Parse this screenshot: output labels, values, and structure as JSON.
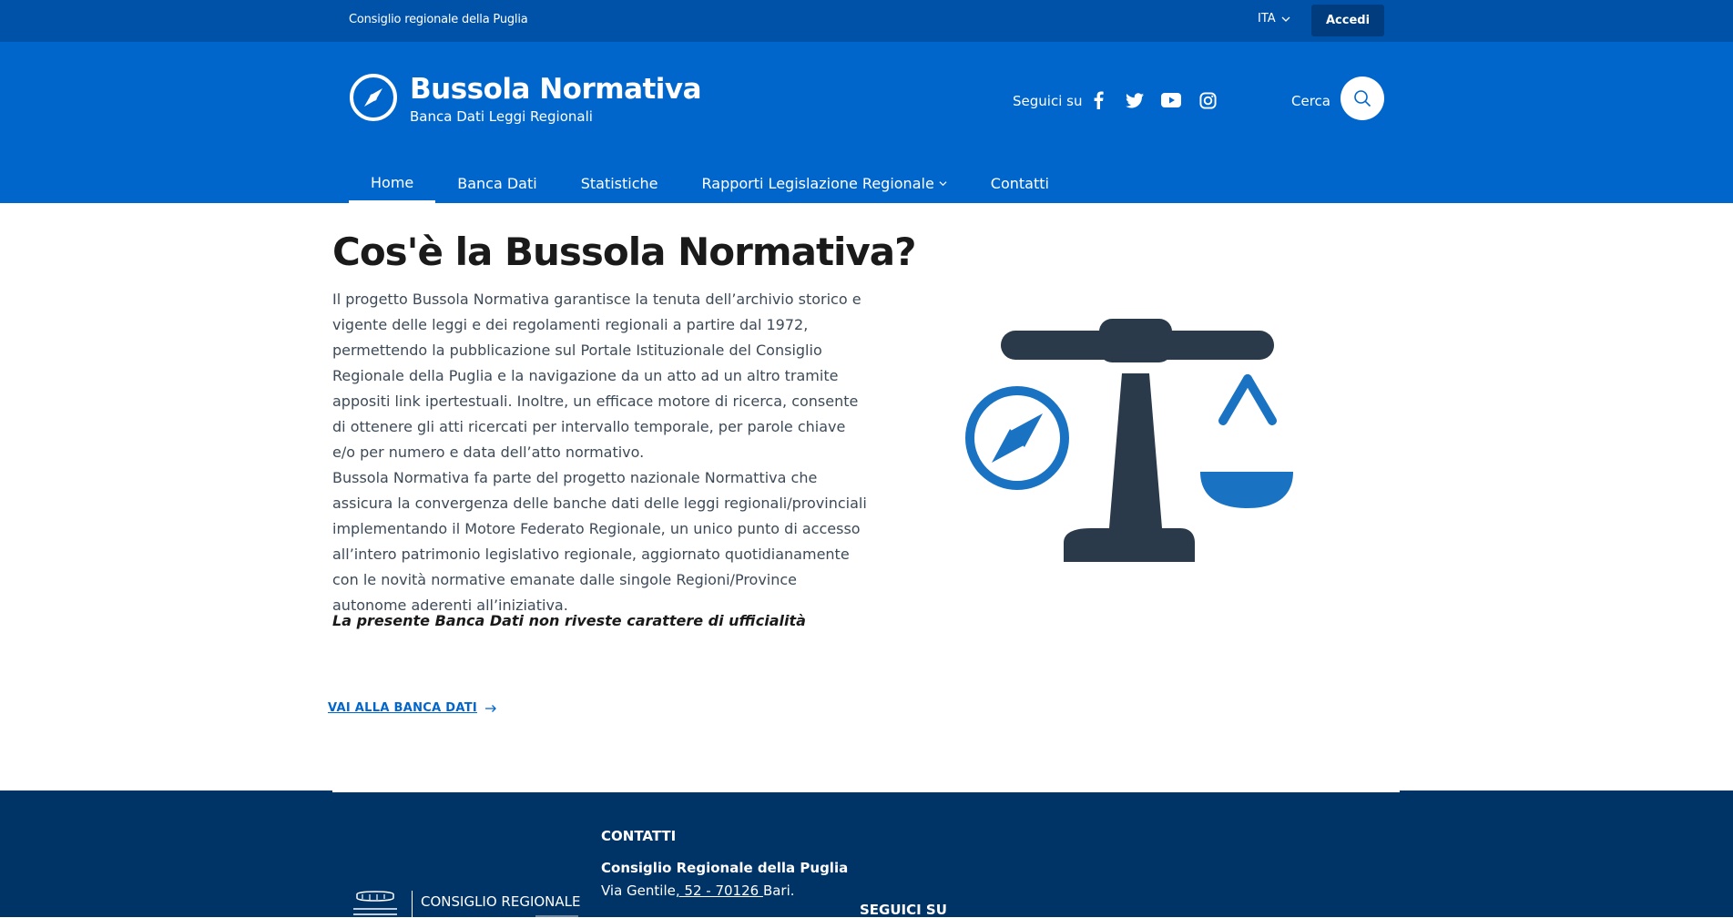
{
  "slim_header": {
    "brand": "Consiglio regionale della Puglia",
    "language": "ITA",
    "login_label": "Accedi"
  },
  "header": {
    "title": "Bussola Normativa",
    "subtitle": "Banca Dati Leggi Regionali",
    "follow_label": "Seguici su",
    "social": [
      "facebook-icon",
      "twitter-icon",
      "youtube-icon",
      "instagram-icon"
    ],
    "search_label": "Cerca"
  },
  "nav": {
    "items": [
      {
        "label": "Home"
      },
      {
        "label": "Banca Dati"
      },
      {
        "label": "Statistiche"
      },
      {
        "label": "Rapporti Legislazione Regionale"
      },
      {
        "label": "Contatti"
      }
    ]
  },
  "main": {
    "heading": "Cos'è la Bussola Normativa?",
    "paragraph1": "Il progetto Bussola Normativa garantisce la tenuta dell’archivio storico e vigente delle leggi e dei regolamenti regionali a partire dal 1972, permettendo la pubblicazione sul Portale Istituzionale del Consiglio Regionale della Puglia e la navigazione da un atto ad un altro tramite appositi link ipertestuali. Inoltre, un efficace motore di ricerca, consente di ottenere gli atti ricercati per intervallo temporale, per parole chiave e/o per numero e data dell’atto normativo.",
    "paragraph2": "Bussola Normativa fa parte del progetto nazionale Normattiva che assicura la convergenza delle banche dati delle leggi regionali/provinciali implementando il Motore Federato Regionale, un unico punto di accesso all’intero patrimonio legislativo regionale, aggiornato quotidianamente con le novità normative emanate dalle singole Regioni/Province autonome aderenti all’iniziativa.",
    "notice": "La presente Banca Dati non riveste carattere di ufficialità",
    "cta_label": "VAI ALLA BANCA DATI"
  },
  "footer": {
    "contacts_heading": "CONTATTI",
    "org_name": "Consiglio Regionale della Puglia",
    "address_prefix": "Via Gentile",
    "address_link": ", 52 - 70126 ",
    "address_suffix": "Bari.",
    "follow_heading": "SEGUICI SU",
    "logo_text": "CONSIGLIO REGIONALE"
  },
  "colors": {
    "slim_bg": "#0052a8",
    "header_bg": "#0066cc",
    "footer_bg": "#003366",
    "illustration_dark": "#2b3a4a",
    "illustration_blue": "#1a73c2"
  }
}
